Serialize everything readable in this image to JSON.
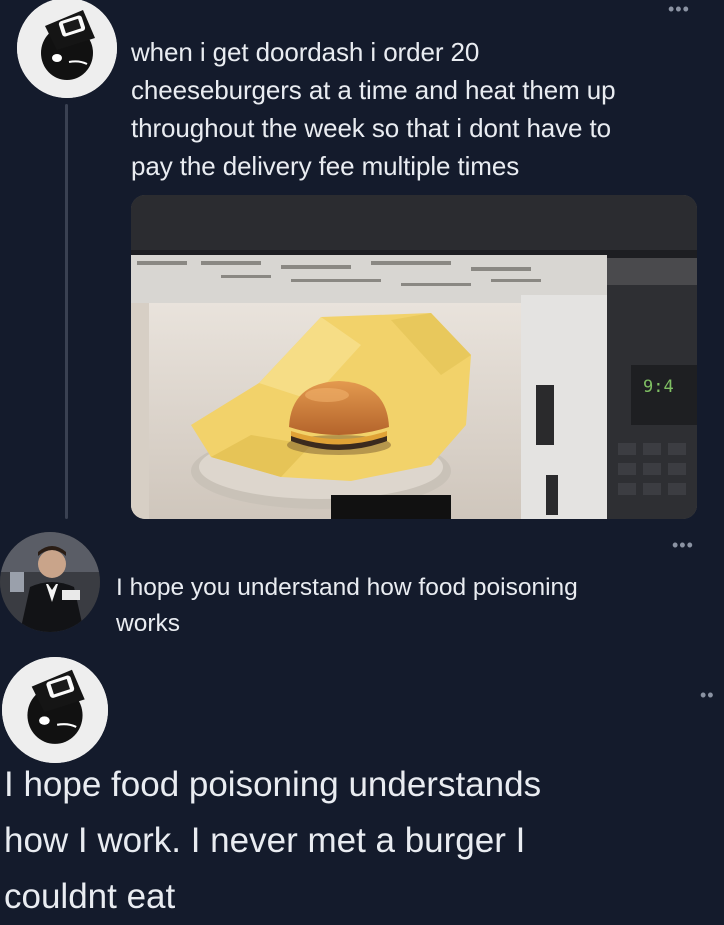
{
  "posts": [
    {
      "text": "when i get doordash i order 20\ncheeseburgers at a time and heat them up\nthroughout the week so that i dont have to\npay the delivery fee multiple times",
      "more_icon": "more-horizontal-icon",
      "media": {
        "subject": "burger-in-microwave",
        "display_readout": "9:4"
      }
    },
    {
      "text": "I hope you understand how food poisoning\nworks",
      "more_icon": "more-horizontal-icon"
    },
    {
      "text": "I hope food poisoning understands\nhow I work. I never met a burger I\ncouldnt eat",
      "more_icon": "more-horizontal-icon"
    }
  ],
  "colors": {
    "background": "#141b2c",
    "text": "#e9ecf1",
    "muted": "#8b93a3"
  }
}
